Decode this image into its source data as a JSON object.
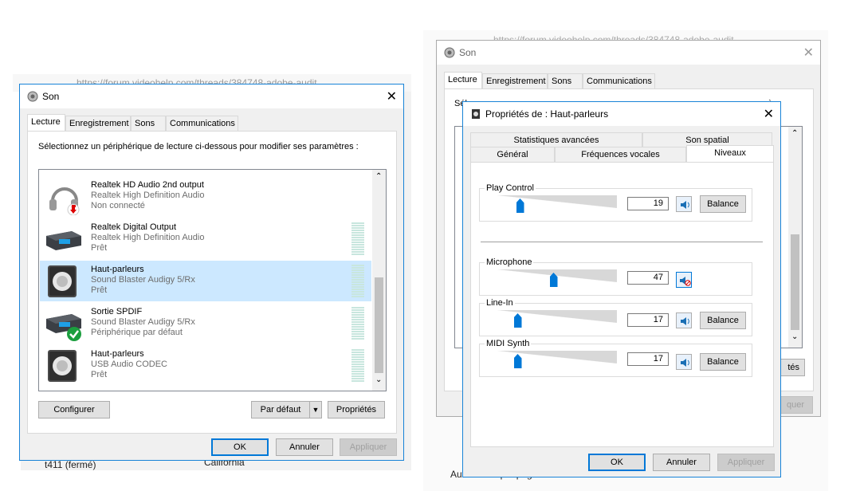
{
  "left": {
    "browser": {
      "url": "https://forum.videohelp.com/threads/384748-adobe-audit"
    },
    "win_title": "Son",
    "tabs": [
      "Lecture",
      "Enregistrement",
      "Sons",
      "Communications"
    ],
    "instruction": "Sélectionnez un périphérique de lecture ci-dessous pour modifier ses paramètres :",
    "devices": [
      {
        "name": "Realtek HD Audio 2nd output",
        "driver": "Realtek High Definition Audio",
        "status": "Non connecté"
      },
      {
        "name": "Realtek Digital Output",
        "driver": "Realtek High Definition Audio",
        "status": "Prêt"
      },
      {
        "name": "Haut-parleurs",
        "driver": "Sound Blaster Audigy 5/Rx",
        "status": "Prêt"
      },
      {
        "name": "Sortie SPDIF",
        "driver": "Sound Blaster Audigy 5/Rx",
        "status": "Périphérique par défaut"
      },
      {
        "name": "Haut-parleurs",
        "driver": "USB Audio CODEC",
        "status": "Prêt"
      }
    ],
    "buttons": {
      "configure": "Configurer",
      "default": "Par défaut",
      "properties": "Propriétés",
      "ok": "OK",
      "cancel": "Annuler",
      "apply": "Appliquer"
    },
    "bg_bottom_text": "t411 (fermé)",
    "bg_bottom_text2": "California"
  },
  "right": {
    "browser": {
      "url": "https://forum.videohelp.com/threads/384748-adobe-audit"
    },
    "win_title": "Son",
    "tabs": [
      "Lecture",
      "Enregistrement",
      "Sons",
      "Communications"
    ],
    "instruction_fragment_a": "Sél",
    "instruction_fragment_b": "ès :",
    "bg_buttons": {
      "properties": "tés",
      "apply": "quer"
    },
    "bg_bottom_text": "Autres marque-pages",
    "props": {
      "title": "Propriétés de : Haut-parleurs",
      "tabs_top": [
        "Statistiques avancées",
        "Son spatial"
      ],
      "tabs_bottom": [
        "Général",
        "Fréquences vocales",
        "Niveaux"
      ],
      "channels": [
        {
          "label": "Play Control",
          "value": "19",
          "level": 0.19,
          "balance": "Balance",
          "muted": false
        },
        {
          "label": "Microphone",
          "value": "47",
          "level": 0.47,
          "balance": "",
          "muted": true
        },
        {
          "label": "Line-In",
          "value": "17",
          "level": 0.17,
          "balance": "Balance",
          "muted": false
        },
        {
          "label": "MIDI Synth",
          "value": "17",
          "level": 0.17,
          "balance": "Balance",
          "muted": false
        }
      ],
      "buttons": {
        "ok": "OK",
        "cancel": "Annuler",
        "apply": "Appliquer"
      }
    }
  }
}
